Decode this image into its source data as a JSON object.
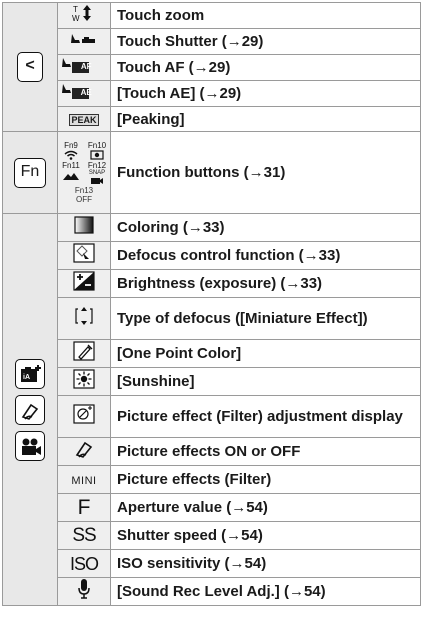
{
  "sections": [
    {
      "side": {
        "type": "key",
        "label": "<",
        "icon": "arrow-left-icon"
      },
      "rows": [
        {
          "icon": "touch-zoom-icon",
          "text": "Touch zoom"
        },
        {
          "icon": "touch-shutter-icon",
          "text": "Touch Shutter (→29)"
        },
        {
          "icon": "touch-af-icon",
          "icon_text": "AF",
          "text": "Touch AF (→29)"
        },
        {
          "icon": "touch-ae-icon",
          "icon_text": "AE",
          "text": "[Touch AE] (→29)"
        },
        {
          "icon": "peaking-icon",
          "icon_text": "PEAK",
          "text": "[Peaking]"
        }
      ]
    },
    {
      "side": {
        "type": "key",
        "label": "Fn",
        "icon": "fn-key-icon"
      },
      "rows": [
        {
          "icon": "function-buttons-icon",
          "icon_labels": {
            "fn9": "Fn9",
            "fn10": "Fn10",
            "fn11": "Fn11",
            "fn12": "Fn12",
            "snap": "SNAP",
            "fn13": "Fn13",
            "off": "OFF"
          },
          "text": "Function buttons (→31)"
        }
      ]
    },
    {
      "side": {
        "type": "modes",
        "icons": [
          "intelligent-auto-plus-icon",
          "creative-control-icon",
          "creative-video-icon"
        ]
      },
      "rows": [
        {
          "icon": "coloring-icon",
          "text": "Coloring (→33)"
        },
        {
          "icon": "defocus-control-icon",
          "text": "Defocus control function (→33)"
        },
        {
          "icon": "brightness-exposure-icon",
          "text": "Brightness (exposure) (→33)"
        },
        {
          "icon": "defocus-type-icon",
          "text": "Type of defocus ([Miniature Effect])"
        },
        {
          "icon": "one-point-color-icon",
          "text": "[One Point Color]"
        },
        {
          "icon": "sunshine-icon",
          "text": "[Sunshine]"
        },
        {
          "icon": "picture-effect-filter-adjust-icon",
          "text": "Picture effect (Filter) adjustment display"
        },
        {
          "icon": "picture-effects-toggle-icon",
          "text": "Picture effects ON or OFF"
        },
        {
          "icon": "mini-icon",
          "icon_text": "MINI",
          "text": "Picture effects (Filter)"
        },
        {
          "icon": "aperture-value-icon",
          "icon_text": "F",
          "text": "Aperture value (→54)"
        },
        {
          "icon": "shutter-speed-icon",
          "icon_text": "SS",
          "text": "Shutter speed (→54)"
        },
        {
          "icon": "iso-sensitivity-icon",
          "icon_text": "ISO",
          "text": "ISO sensitivity (→54)"
        },
        {
          "icon": "microphone-icon",
          "text": "[Sound Rec Level Adj.] (→54)"
        }
      ]
    }
  ]
}
